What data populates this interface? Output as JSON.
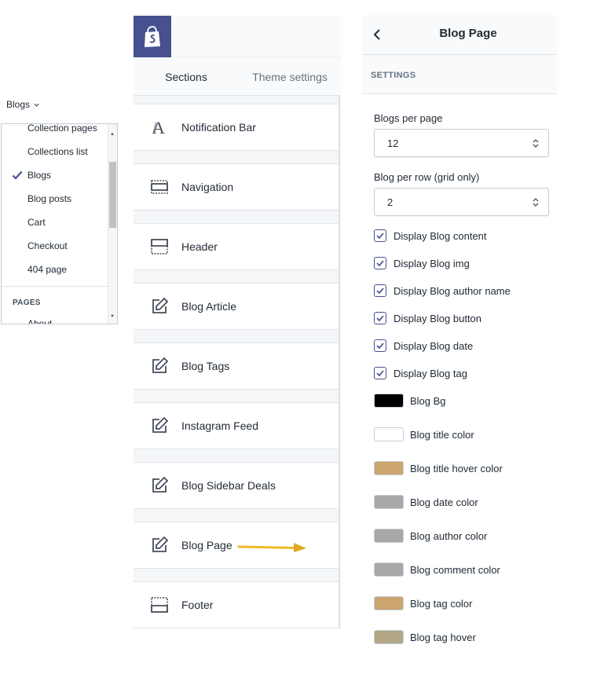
{
  "dropdown": {
    "trigger_label": "Blogs",
    "items": [
      {
        "label": "Collection pages",
        "selected": false
      },
      {
        "label": "Collections list",
        "selected": false
      },
      {
        "label": "Blogs",
        "selected": true
      },
      {
        "label": "Blog posts",
        "selected": false
      },
      {
        "label": "Cart",
        "selected": false
      },
      {
        "label": "Checkout",
        "selected": false
      },
      {
        "label": "404 page",
        "selected": false
      }
    ],
    "group_heading": "PAGES",
    "group_items": [
      {
        "label": "About"
      }
    ]
  },
  "editor": {
    "tabs": [
      {
        "label": "Sections",
        "active": true
      },
      {
        "label": "Theme settings",
        "active": false
      }
    ],
    "sections": [
      {
        "label": "Notification Bar",
        "icon": "text-icon"
      },
      {
        "label": "Navigation",
        "icon": "navigation-layout-icon"
      },
      {
        "label": "Header",
        "icon": "header-layout-icon"
      },
      {
        "label": "Blog Article",
        "icon": "edit-icon"
      },
      {
        "label": "Blog Tags",
        "icon": "edit-icon"
      },
      {
        "label": "Instagram Feed",
        "icon": "edit-icon"
      },
      {
        "label": "Blog Sidebar Deals",
        "icon": "edit-icon"
      },
      {
        "label": "Blog Page",
        "icon": "edit-icon"
      },
      {
        "label": "Footer",
        "icon": "footer-layout-icon"
      }
    ],
    "annotation_arrow_color": "#f0b929"
  },
  "settings": {
    "title": "Blog Page",
    "subtitle": "SETTINGS",
    "selects": [
      {
        "label": "Blogs per page",
        "value": "12"
      },
      {
        "label": "Blog per row (grid only)",
        "value": "2"
      }
    ],
    "checkboxes": [
      {
        "label": "Display Blog content",
        "checked": true
      },
      {
        "label": "Display Blog img",
        "checked": true
      },
      {
        "label": "Display Blog author name",
        "checked": true
      },
      {
        "label": "Display Blog button",
        "checked": true
      },
      {
        "label": "Display Blog date",
        "checked": true
      },
      {
        "label": "Display Blog tag",
        "checked": true
      }
    ],
    "colors": [
      {
        "label": "Blog Bg",
        "color": "#000000"
      },
      {
        "label": "Blog title color",
        "color": "#ffffff"
      },
      {
        "label": "Blog title hover color",
        "color": "#cca56f"
      },
      {
        "label": "Blog date color",
        "color": "#a8a8a8"
      },
      {
        "label": "Blog author color",
        "color": "#a8a8a8"
      },
      {
        "label": "Blog comment color",
        "color": "#a8a8a8"
      },
      {
        "label": "Blog tag color",
        "color": "#cca56f"
      },
      {
        "label": "Blog tag hover",
        "color": "#b2a886"
      }
    ]
  },
  "theme": {
    "accent": "#47518f",
    "brand_bg": "#47518f"
  }
}
